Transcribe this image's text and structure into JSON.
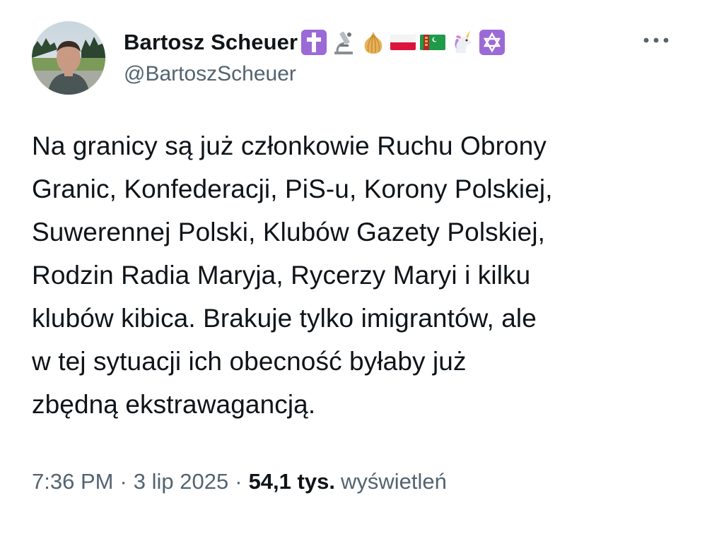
{
  "author": {
    "display_name": "Bartosz Scheuer",
    "handle": "@BartoszScheuer",
    "name_emojis": [
      "latin-cross-emoji",
      "microscope-emoji",
      "onion-emoji",
      "poland-flag-emoji",
      "turkmenistan-flag-emoji",
      "unicorn-emoji",
      "star-of-david-emoji"
    ]
  },
  "tweet": {
    "lines": [
      "Na granicy są już członkowie Ruchu Obrony",
      "Granic, Konfederacji, PiS-u, Korony Polskiej,",
      "Suwerennej Polski, Klubów Gazety Polskiej,",
      "Rodzin Radia Maryja, Rycerzy Maryi i kilku",
      "klubów kibica. Brakuje tylko imigrantów, ale",
      "w tej sytuacji ich obecność byłaby już",
      "zbędną ekstrawagancją."
    ]
  },
  "meta": {
    "time": "7:36 PM",
    "separator": "·",
    "date": "3 lip 2025",
    "views_count": "54,1 tys.",
    "views_label": "wyświetleń"
  },
  "colors": {
    "text": "#0f1419",
    "secondary": "#536471",
    "cross_box": "#9b6ad6",
    "star_box": "#9b6ad6"
  },
  "icons": {
    "more": "more-horizontal-icon"
  }
}
